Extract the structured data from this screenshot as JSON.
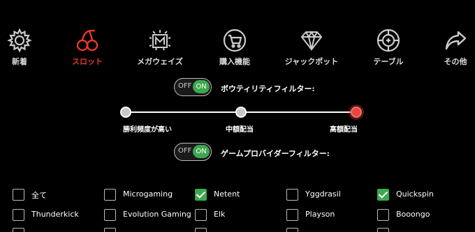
{
  "categories": [
    {
      "label": "新着",
      "icon": "gear-icon",
      "active": false
    },
    {
      "label": "スロット",
      "icon": "cherry-icon",
      "active": true
    },
    {
      "label": "メガウェイズ",
      "icon": "mega-m-icon",
      "active": false
    },
    {
      "label": "購入機能",
      "icon": "cart-icon",
      "active": false
    },
    {
      "label": "ジャックポット",
      "icon": "diamond-icon",
      "active": false
    },
    {
      "label": "テーブル",
      "icon": "chip-icon",
      "active": false
    },
    {
      "label": "その他",
      "icon": "share-arrow-icon",
      "active": false
    }
  ],
  "volatility_filter": {
    "label": "ボウティリティフィルター:",
    "off_text": "OFF",
    "on_text": "ON",
    "state": "on"
  },
  "volatility_slider": {
    "stops": [
      "勝利頻度が高い",
      "中額配当",
      "高額配当"
    ],
    "selected_index": 2
  },
  "provider_filter": {
    "label": "ゲームプロバイダーフィルター:",
    "off_text": "OFF",
    "on_text": "ON",
    "state": "on"
  },
  "providers": [
    [
      {
        "label": "全て",
        "checked": false
      },
      {
        "label": "Microgaming",
        "checked": false
      },
      {
        "label": "Netent",
        "checked": true
      },
      {
        "label": "Yggdrasil",
        "checked": false
      },
      {
        "label": "Quickspin",
        "checked": true
      }
    ],
    [
      {
        "label": "Thunderkick",
        "checked": false
      },
      {
        "label": "Evolution Gaming",
        "checked": false
      },
      {
        "label": "Elk",
        "checked": false
      },
      {
        "label": "Playson",
        "checked": false
      },
      {
        "label": "Booongo",
        "checked": false
      }
    ]
  ],
  "colors": {
    "accent_red": "#e8382a",
    "toggle_green": "#3ca84f"
  }
}
